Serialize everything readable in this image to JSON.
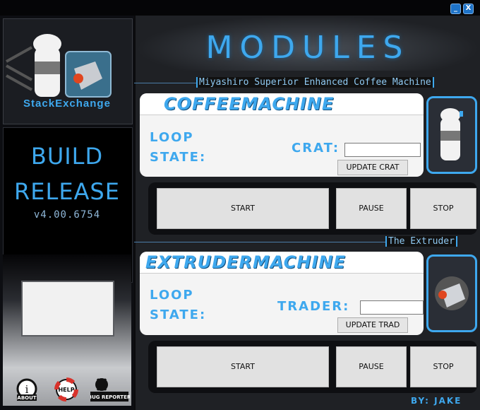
{
  "window": {
    "minimize_label": "_",
    "close_label": "X"
  },
  "sidebar": {
    "logo_text": "StackExchange",
    "build_line1": "BUILD",
    "build_line2": "RELEASE",
    "version": "v4.00.6754",
    "icons": [
      {
        "name": "about-icon",
        "label": "ABOUT"
      },
      {
        "name": "help-icon",
        "label": "HELP"
      },
      {
        "name": "bug-reporter-icon",
        "label": "BUG REPORTER"
      }
    ]
  },
  "main": {
    "title": "MODULES",
    "modules": [
      {
        "section_label": "Miyashiro Superior Enhanced Coffee Machine",
        "title": "COFFEEMACHINE",
        "loop_label": "LOOP",
        "state_label": "STATE:",
        "field_label": "CRAT:",
        "field_value": "",
        "update_label": "UPDATE CRAT",
        "start_label": "START",
        "pause_label": "PAUSE",
        "stop_label": "STOP"
      },
      {
        "section_label": "The Extruder",
        "title": "EXTRUDERMACHINE",
        "loop_label": "LOOP",
        "state_label": "STATE:",
        "field_label": "TRADER:",
        "field_value": "",
        "update_label": "UPDATE TRAD",
        "start_label": "START",
        "pause_label": "PAUSE",
        "stop_label": "STOP"
      }
    ],
    "byline": "BY: JAKE"
  },
  "colors": {
    "accent": "#3ea8ee",
    "panel": "#f4f4f4",
    "background": "#1f2125"
  }
}
